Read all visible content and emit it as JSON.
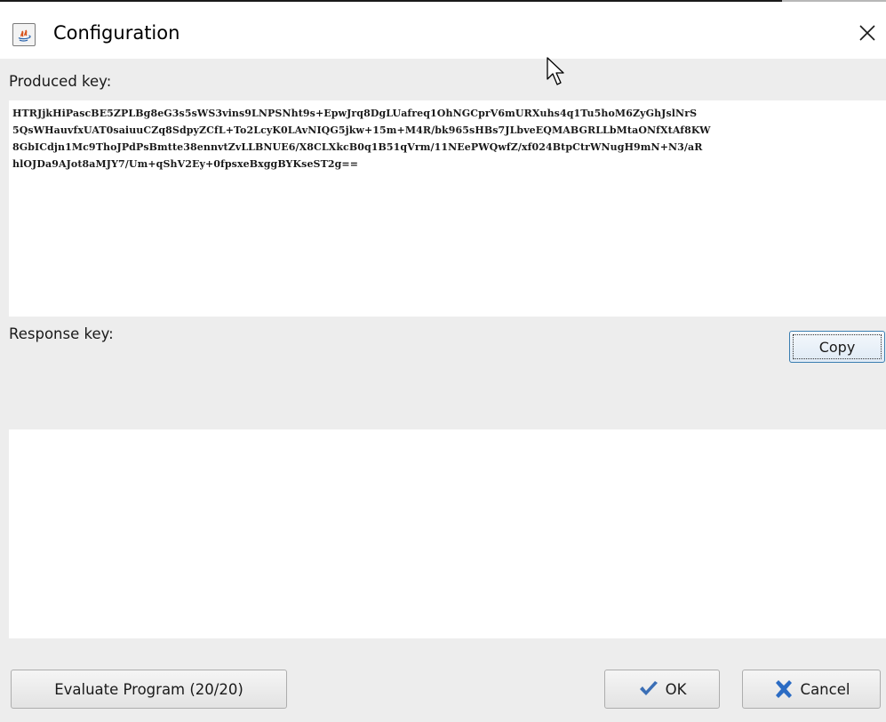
{
  "window": {
    "title": "Configuration",
    "app_icon": "java-icon",
    "close_icon": "close-icon"
  },
  "produced_key": {
    "label": "Produced key:",
    "lines": [
      "HTRJjkHiPascBE5ZPLBg8eG3s5sWS3vins9LNPSNht9s+EpwJrq8DgLUafreq1OhNGCprV6mURXuhs4q1Tu5hoM6ZyGhJslNrS",
      "5QsWHauvfxUAT0saiuuCZq8SdpyZCfL+To2LcyK0LAvNIQG5jkw+15m+M4R/bk965sHBs7JLbveEQMABGRLLbMtaONfXtAf8KW",
      "8GbICdjn1Mc9ThoJPdPsBmtte38ennvtZvLLBNUE6/X8CLXkcB0q1B51qVrm/11NEePWQwfZ/xf024BtpCtrWNugH9mN+N3/aR",
      "hlOJDa9AJot8aMJY7/Um+qShV2Ey+0fpsxeBxggBYKseST2g=="
    ]
  },
  "copy_button": {
    "label": "Copy"
  },
  "response_key": {
    "label": "Response key:",
    "value": ""
  },
  "buttons": {
    "evaluate_label": "Evaluate Program (20/20)",
    "ok_label": "OK",
    "ok_icon": "checkmark-icon",
    "cancel_label": "Cancel",
    "cancel_icon": "x-icon"
  },
  "colors": {
    "window_bg": "#ededed",
    "field_bg": "#ffffff",
    "ok_icon_color": "#3b6fb6",
    "cancel_icon_color": "#2b6cc4",
    "focus_border": "#3c7fb1"
  }
}
